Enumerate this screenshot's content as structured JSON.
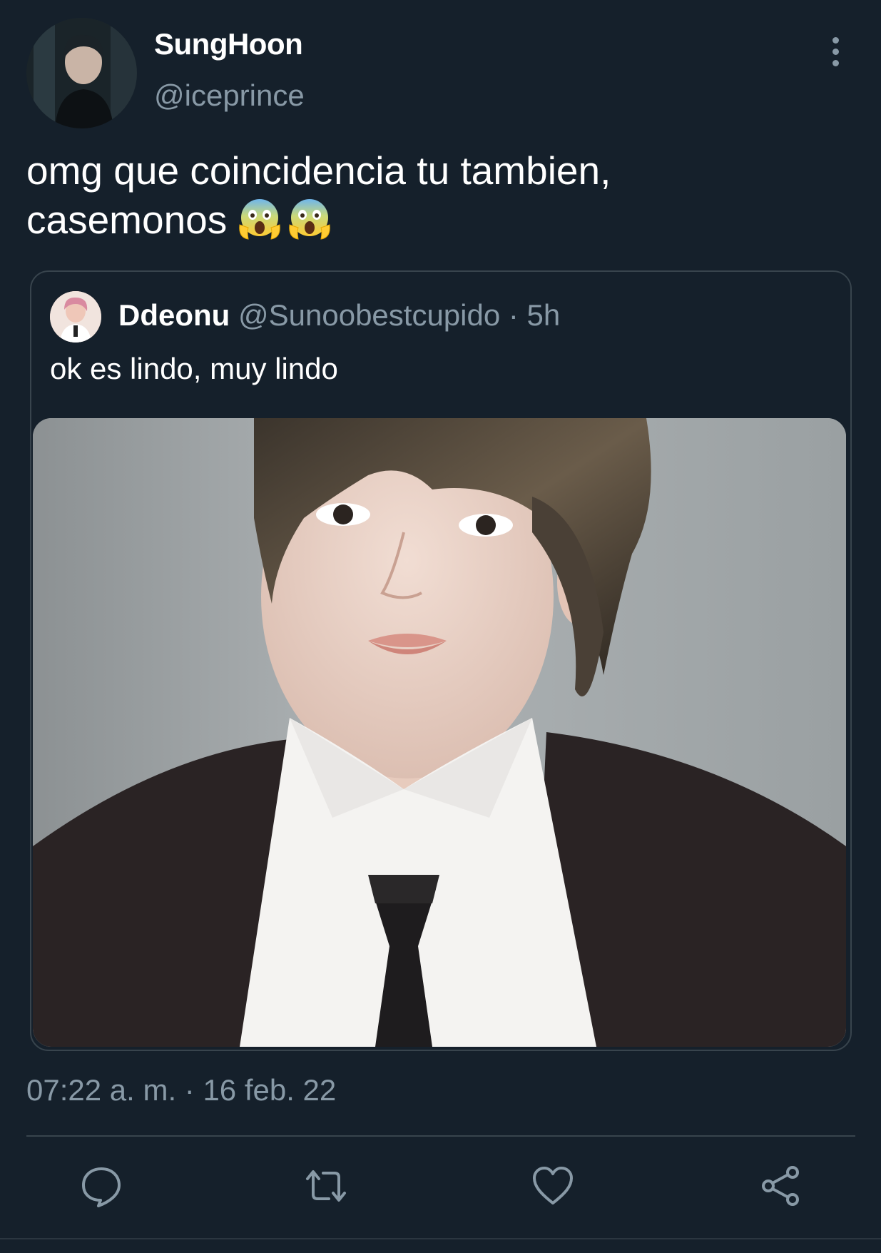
{
  "tweet": {
    "author": {
      "display_name": "SungHoon",
      "handle": "@iceprince"
    },
    "text": "omg que coincidencia tu tambien,\ncasemonos",
    "emojis": [
      "😱",
      "😱"
    ],
    "timestamp": "07:22 a. m. · 16 feb. 22"
  },
  "quote": {
    "display_name": "Ddeonu",
    "handle": "@Sunoobestcupido",
    "time": "· 5h",
    "text": "ok es lindo, muy lindo"
  },
  "icons": {
    "more": "more-vertical-icon",
    "reply": "reply-icon",
    "retweet": "retweet-icon",
    "like": "heart-icon",
    "share": "share-icon"
  },
  "colors": {
    "background": "#15202b",
    "text_primary": "#ffffff",
    "text_secondary": "#8899a6",
    "border": "#38444d"
  }
}
